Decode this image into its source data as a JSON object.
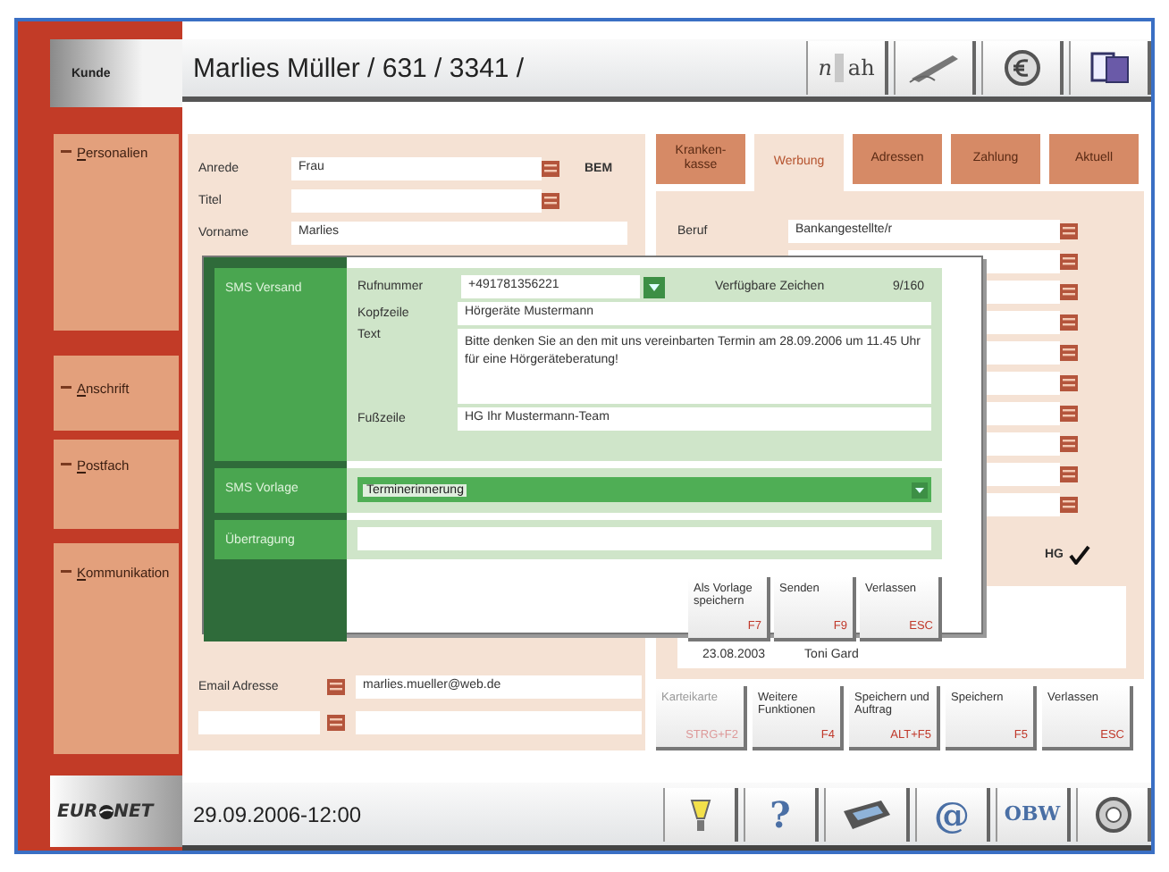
{
  "header": {
    "section": "Kunde",
    "title": "Marlies Müller / 631 / 3341 /",
    "tools": [
      {
        "kind": "split",
        "parts": [
          "n",
          "ah"
        ]
      },
      {
        "kind": "pen"
      },
      {
        "kind": "coin"
      },
      {
        "kind": "document"
      }
    ]
  },
  "sidebar": [
    {
      "label": "Personalien"
    },
    {
      "label": "Anschrift"
    },
    {
      "label": "Postfach"
    },
    {
      "label": "Kommunikation"
    }
  ],
  "form": {
    "rows": [
      {
        "label": "Anrede",
        "value": "Frau",
        "kind": "picker",
        "note": "BEM"
      },
      {
        "label": "Titel",
        "kind": "picker"
      },
      {
        "label": "Vorname",
        "value": "Marlies",
        "kind": "plain"
      }
    ],
    "contacts": [
      {
        "label": "Email Adresse",
        "value": "marlies.mueller@web.de",
        "kind": "picker"
      },
      {
        "kind": "picker"
      }
    ]
  },
  "tabs": [
    {
      "label": "Kranken-kasse",
      "selected": false
    },
    {
      "label": "Werbung",
      "selected": true
    },
    {
      "label": "Adressen",
      "selected": false
    },
    {
      "label": "Zahlung",
      "selected": false
    },
    {
      "label": "Aktuell",
      "selected": false
    }
  ],
  "profile": {
    "rows": [
      {
        "label": "Beruf",
        "value": "Bankangestellte/r",
        "kind": "picker"
      },
      {
        "kind": "picker"
      },
      {
        "kind": "picker"
      },
      {
        "kind": "picker"
      },
      {
        "kind": "picker"
      },
      {
        "kind": "picker"
      },
      {
        "kind": "picker"
      },
      {
        "kind": "picker"
      },
      {
        "kind": "picker"
      },
      {
        "kind": "picker"
      }
    ],
    "hg": {
      "label": "HG",
      "checked": true
    },
    "history": [
      {
        "date": "23.08.2003",
        "name": "Toni Gard"
      }
    ]
  },
  "actions": [
    {
      "label": "Karteikarte",
      "key": "STRG+F2",
      "disabled": true
    },
    {
      "label": "Weitere Funktionen",
      "key": "F4",
      "disabled": false
    },
    {
      "label": "Speichern und Auftrag",
      "key": "ALT+F5",
      "disabled": false
    },
    {
      "label": "Speichern",
      "key": "F5",
      "disabled": false
    },
    {
      "label": "Verlassen",
      "key": "ESC",
      "disabled": false
    }
  ],
  "dialog": {
    "sections": [
      {
        "label": "SMS Versand"
      },
      {
        "label": "SMS Vorlage"
      },
      {
        "label": "Übertragung"
      }
    ],
    "phone": {
      "label": "Rufnummer",
      "value": "+491781356221"
    },
    "chars": {
      "label": "Verfügbare Zeichen",
      "value": "9/160"
    },
    "header_line": {
      "label": "Kopfzeile",
      "value": "Hörgeräte Mustermann"
    },
    "text": {
      "label": "Text",
      "value": "Bitte denken Sie an den mit uns vereinbarten Termin am 28.09.2006 um 11.45 Uhr für eine Hörgeräteberatung!"
    },
    "footer_line": {
      "label": "Fußzeile",
      "value": "HG Ihr Mustermann-Team"
    },
    "template": {
      "value": "Terminerinnerung"
    },
    "buttons": [
      {
        "label": "Als Vorlage speichern",
        "key": "F7"
      },
      {
        "label": "Senden",
        "key": "F9"
      },
      {
        "label": "Verlassen",
        "key": "ESC"
      }
    ]
  },
  "status": {
    "logo": [
      "EUR",
      "NET"
    ],
    "datetime": "29.09.2006-12:00",
    "tools": [
      {
        "kind": "bulb"
      },
      {
        "kind": "text",
        "label": "?"
      },
      {
        "kind": "device"
      },
      {
        "kind": "text",
        "label": "@"
      },
      {
        "kind": "text",
        "label": "OBW"
      },
      {
        "kind": "globe"
      }
    ]
  }
}
